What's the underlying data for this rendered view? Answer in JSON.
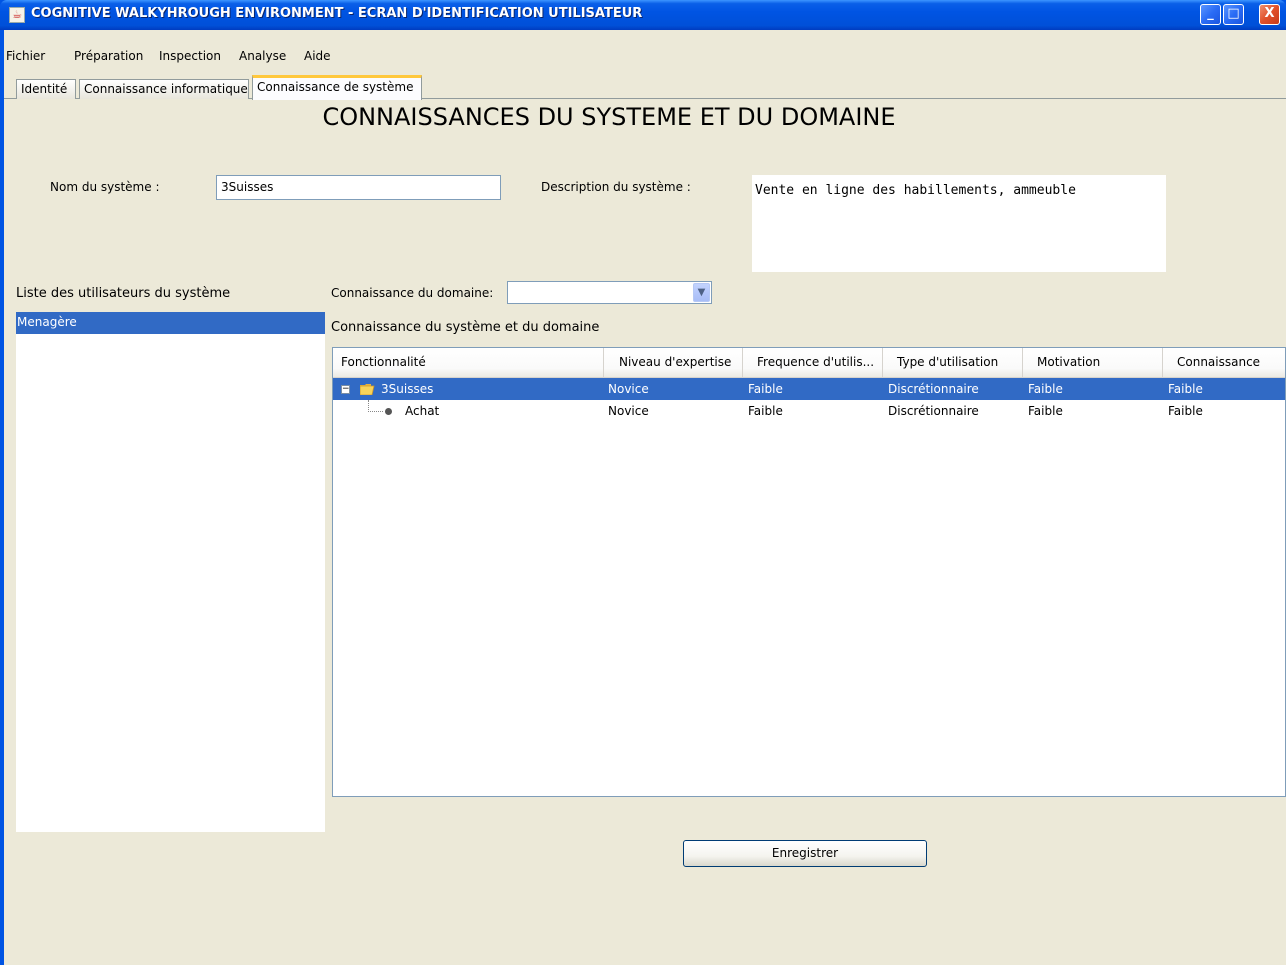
{
  "window": {
    "title": "COGNITIVE WALKYHROUGH ENVIRONMENT - ECRAN D'IDENTIFICATION UTILISATEUR",
    "app_icon": "java-cup-icon",
    "controls": {
      "minimize": "_",
      "maximize": "□",
      "close": "X"
    }
  },
  "menubar": {
    "items": [
      "Fichier",
      "Préparation",
      "Inspection",
      "Analyse",
      "Aide"
    ]
  },
  "tabs": [
    {
      "label": "Identité",
      "active": false
    },
    {
      "label": "Connaissance informatique",
      "active": false
    },
    {
      "label": "Connaissance de système",
      "active": true
    }
  ],
  "heading": "CONNAISSANCES DU SYSTEME ET DU DOMAINE",
  "form": {
    "system_name_label": "Nom du système :",
    "system_name_value": "3Suisses",
    "description_label": "Description du système :",
    "description_value": "Vente en ligne des habillements, ammeuble"
  },
  "users": {
    "label": "Liste des utilisateurs du système",
    "items": [
      "Menagère"
    ],
    "selected_color": "#316ac5"
  },
  "domain": {
    "label": "Connaissance du domaine:",
    "value": ""
  },
  "knowledge_table": {
    "label": "Connaissance du système et du domaine",
    "columns": [
      "Fonctionnalité",
      "Niveau d'expertise",
      "Frequence d'utilis...",
      "Type d'utilisation",
      "Motivation",
      "Connaissance"
    ],
    "rows": [
      {
        "name": "3Suisses",
        "level": "Novice",
        "frequency": "Faible",
        "type": "Discrétionnaire",
        "motivation": "Faible",
        "knowledge": "Faible",
        "node": "folder",
        "expanded": true,
        "selected": true
      },
      {
        "name": "Achat",
        "level": "Novice",
        "frequency": "Faible",
        "type": "Discrétionnaire",
        "motivation": "Faible",
        "knowledge": "Faible",
        "node": "leaf",
        "selected": false
      }
    ]
  },
  "save_button": "Enregistrer"
}
